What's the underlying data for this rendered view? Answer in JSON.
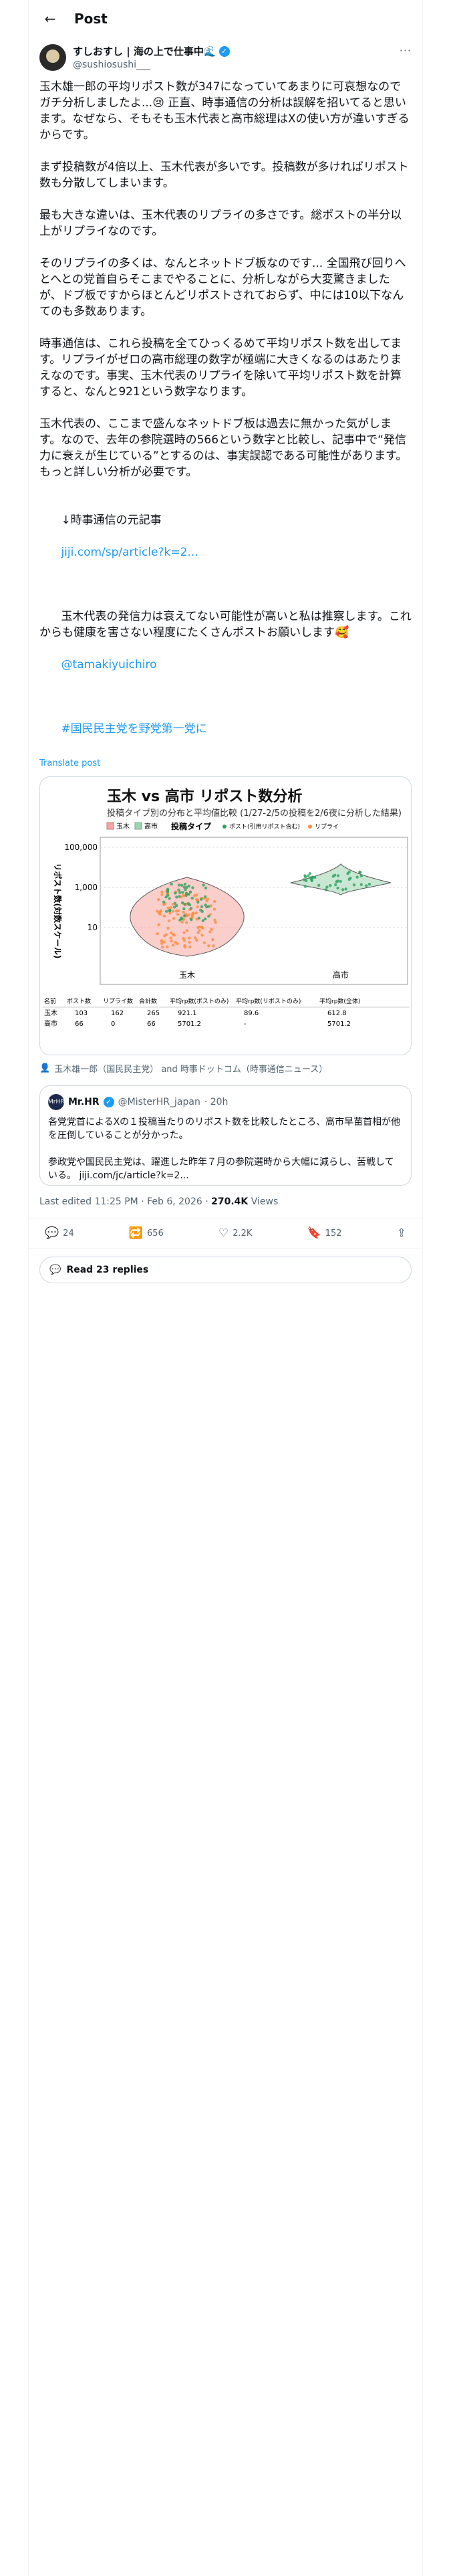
{
  "header": {
    "title": "Post"
  },
  "author": {
    "display_name": "すしおすし | 海の上で仕事中🌊",
    "handle": "@sushiosushi___"
  },
  "post": {
    "paragraphs": [
      "玉木雄一郎の平均リポスト数が347になってい​てあまりに可哀想なのでガチ分析しましたよ...😢 正直、時事通信の分析は誤解を招いてると思います。なぜなら、そもそも玉木代表と高市総理はXの使い方が違いすぎるからです。",
      "まず投稿数が4倍以上、玉木代表が多いです。投稿数が多ければリポスト数も分散してしまいます。",
      "最も大きな違いは、玉木代表のリプライの多さです。総ポストの半分以上がリプライなのです。",
      "そのリプライの多くは、なんとネットドブ板なのです... 全国飛び回りへとへとの党首自らそこまでやることに、分析しながら大変驚きましたが、ドブ板ですからほとんどリポストされておらず、中には10以下なんてのも多数あります。",
      "時事通信は、これら投稿を全てひっくるめて平均リポスト数を出してます。リプライがゼロの高市総理の数字が極端に大きくなるのはあたりまえなのです。事実、玉木代表のリプライを除いて平均リポスト数を計算すると、なんと921という数字なります。",
      "玉木代表の、ここまで盛んなネットドブ板は過去に無かった気がします。なので、去年の参院選時の566という数字と比較し、記事中で“発信力に衰えが生じている”とするのは、事実誤認である可能性があります。もっと詳しい分析が必要です。"
    ],
    "ref_label": "↓時事通信の元記事",
    "ref_link": "jiji.com/sp/article?k=2...",
    "closing": "玉木代表の発信力は衰えてない可能性が高いと私は推察します。これからも健康を害さない程度にたくさんポストお願いします🥰",
    "mention": "@tamakiyuichiro",
    "hashtag": "#国民民主党を野党第一党に",
    "translate": "Translate post"
  },
  "chart_data": {
    "type": "violin",
    "title": "玉木 vs 高市 リポスト数分析",
    "subtitle": "投稿タイプ別の分布と平均値比較 (1/27-2/5の投稿を2/6夜に分析した結果)",
    "ylabel": "リポスト数(対数スケール)",
    "yscale": "log",
    "yticks": [
      "10",
      "1,000",
      "100,000"
    ],
    "categories": [
      "玉木",
      "高市"
    ],
    "legend_person": [
      "玉木",
      "高市"
    ],
    "legend_type_title": "投稿タイプ",
    "legend_types": [
      "ポスト(引用リポスト含む)",
      "リプライ"
    ],
    "colors": {
      "tamaki": "#f4a6a0",
      "takaichi": "#9fd3b1",
      "post": "#2ca25f",
      "reply": "#fd8d3c"
    },
    "table": {
      "headers": [
        "名前",
        "ポスト数",
        "リプライ数",
        "合計数",
        "平均rp数(ポストのみ)",
        "平均rp数(リポストのみ)",
        "平均rp数(全体)"
      ],
      "rows": [
        [
          "玉木",
          "103",
          "162",
          "265",
          "921.1",
          "89.6",
          "612.8"
        ],
        [
          "高市",
          "66",
          "0",
          "66",
          "5701.2",
          "-",
          "5701.2"
        ]
      ]
    }
  },
  "source": "玉木雄一郎（国民民主党） and 時事ドットコム（時事通信ニュース）",
  "quote": {
    "avatar_text": "MrHR",
    "name": "Mr.HR",
    "handle": "@MisterHR_japan",
    "time": "· 20h",
    "text": "各党党首によるXの１投稿当たりのリポスト数を比較したところ、高市早苗首相が他を圧倒していることが分かった。\n\n参政党や国民民主党は、躍進した昨年７月の参院選時から大幅に減らし、苦戦している。 jiji.com/jc/article?k=2..."
  },
  "meta": {
    "edited": "Last edited 11:25 PM · Feb 6, 2026 · ",
    "views_count": "270.4K",
    "views_label": " Views"
  },
  "actions": {
    "replies": "24",
    "reposts": "656",
    "likes": "2.2K",
    "bookmarks": "152"
  },
  "read_replies": "Read 23 replies"
}
